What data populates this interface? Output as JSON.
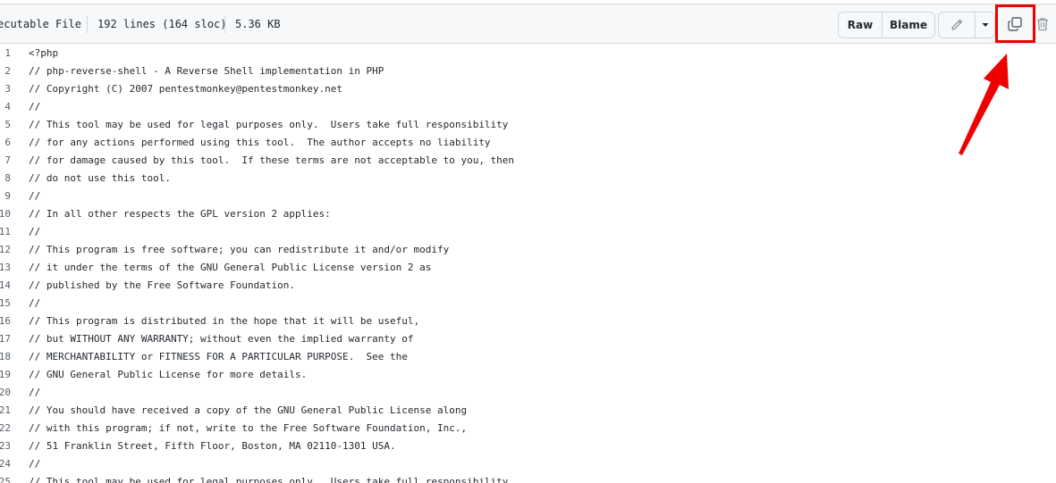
{
  "file_info": {
    "type": "ecutable File",
    "lines": "192 lines (164 sloc)",
    "size": "5.36 KB"
  },
  "toolbar": {
    "raw_label": "Raw",
    "blame_label": "Blame",
    "edit_icon": "pencil-icon",
    "dropdown_icon": "triangle-down-icon",
    "copy_icon": "copy-icon",
    "delete_icon": "trash-icon"
  },
  "code": {
    "lines": [
      {
        "n": "1",
        "t": "<?php"
      },
      {
        "n": "2",
        "t": "// php-reverse-shell - A Reverse Shell implementation in PHP"
      },
      {
        "n": "3",
        "t": "// Copyright (C) 2007 pentestmonkey@pentestmonkey.net"
      },
      {
        "n": "4",
        "t": "//"
      },
      {
        "n": "5",
        "t": "// This tool may be used for legal purposes only.  Users take full responsibility"
      },
      {
        "n": "6",
        "t": "// for any actions performed using this tool.  The author accepts no liability"
      },
      {
        "n": "7",
        "t": "// for damage caused by this tool.  If these terms are not acceptable to you, then"
      },
      {
        "n": "8",
        "t": "// do not use this tool."
      },
      {
        "n": "9",
        "t": "//"
      },
      {
        "n": "10",
        "t": "// In all other respects the GPL version 2 applies:"
      },
      {
        "n": "11",
        "t": "//"
      },
      {
        "n": "12",
        "t": "// This program is free software; you can redistribute it and/or modify"
      },
      {
        "n": "13",
        "t": "// it under the terms of the GNU General Public License version 2 as"
      },
      {
        "n": "14",
        "t": "// published by the Free Software Foundation."
      },
      {
        "n": "15",
        "t": "//"
      },
      {
        "n": "16",
        "t": "// This program is distributed in the hope that it will be useful,"
      },
      {
        "n": "17",
        "t": "// but WITHOUT ANY WARRANTY; without even the implied warranty of"
      },
      {
        "n": "18",
        "t": "// MERCHANTABILITY or FITNESS FOR A PARTICULAR PURPOSE.  See the"
      },
      {
        "n": "19",
        "t": "// GNU General Public License for more details."
      },
      {
        "n": "20",
        "t": "//"
      },
      {
        "n": "21",
        "t": "// You should have received a copy of the GNU General Public License along"
      },
      {
        "n": "22",
        "t": "// with this program; if not, write to the Free Software Foundation, Inc.,"
      },
      {
        "n": "23",
        "t": "// 51 Franklin Street, Fifth Floor, Boston, MA 02110-1301 USA."
      },
      {
        "n": "24",
        "t": "//"
      },
      {
        "n": "25",
        "t": "// This tool may be used for legal purposes only.  Users take full responsibility"
      }
    ]
  },
  "annotation": {
    "highlight_color": "#ef0000"
  }
}
